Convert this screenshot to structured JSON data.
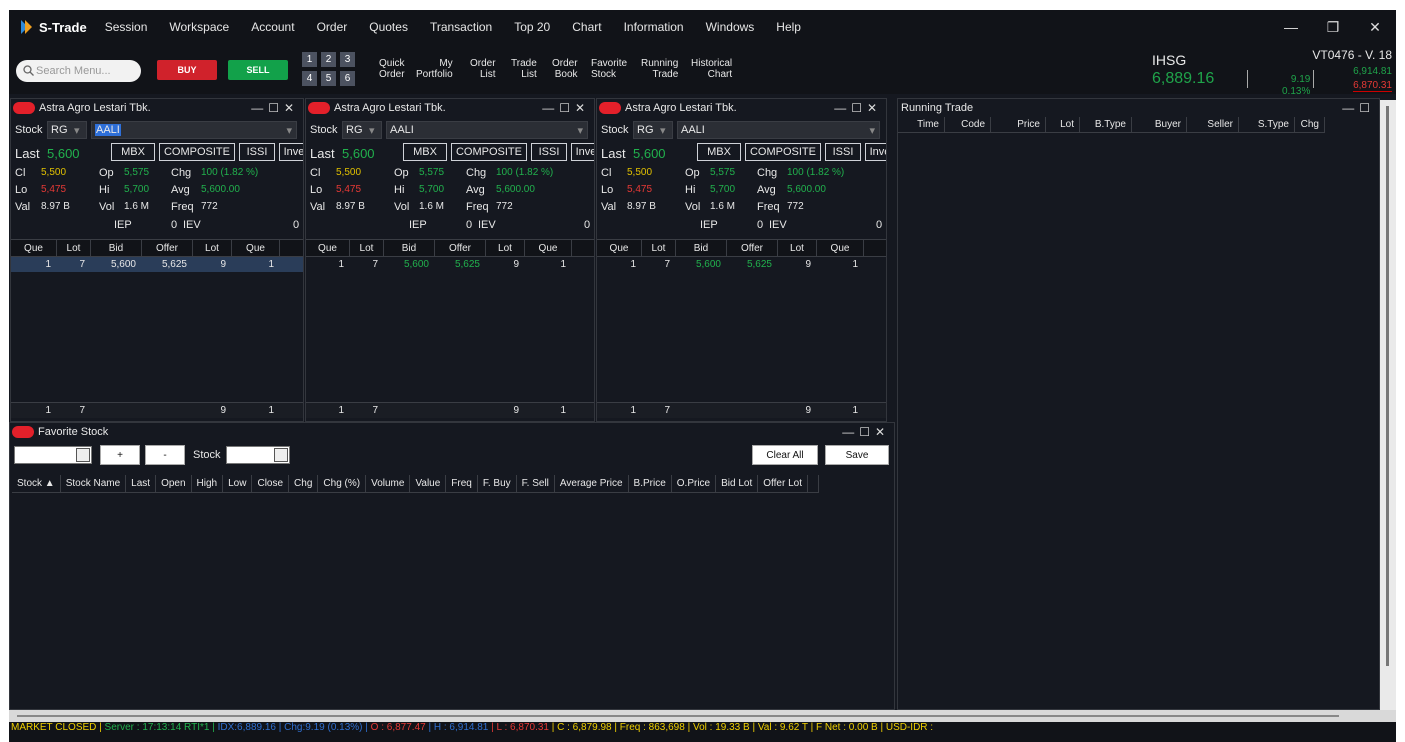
{
  "app": {
    "name": "S-Trade"
  },
  "menu": [
    "Session",
    "Workspace",
    "Account",
    "Order",
    "Quotes",
    "Transaction",
    "Top 20",
    "Chart",
    "Information",
    "Windows",
    "Help"
  ],
  "window_controls": {
    "minimize": "—",
    "restore": "❐",
    "close": "✕"
  },
  "toolbar": {
    "search_placeholder": "Search Menu...",
    "buy": "BUY",
    "sell": "SELL",
    "num_buttons": [
      "1",
      "2",
      "3",
      "4",
      "5",
      "6"
    ],
    "tool_buttons": [
      {
        "l1": "Quick",
        "l2": "Order"
      },
      {
        "l1": "My",
        "l2": "Portfolio"
      },
      {
        "l1": "Order",
        "l2": "List"
      },
      {
        "l1": "Trade",
        "l2": "List"
      },
      {
        "l1": "Order",
        "l2": "Book"
      },
      {
        "l1": "Favorite",
        "l2": "Stock"
      },
      {
        "l1": "Running",
        "l2": "Trade"
      },
      {
        "l1": "Historical",
        "l2": "Chart"
      }
    ]
  },
  "ihsg": {
    "name": "IHSG",
    "value": "6,889.16",
    "chg": "9.19",
    "chg_pct": "0.13%",
    "account": "VT0476 - V. 18",
    "high": "6,914.81",
    "low": "6,870.31"
  },
  "quote": {
    "title": "Astra Agro Lestari Tbk.",
    "stock_label": "Stock",
    "board": "RG",
    "code": "AALI",
    "last_label": "Last",
    "last": "5,600",
    "tabs": [
      "MBX",
      "COMPOSITE",
      "ISSI",
      "Inve"
    ],
    "cl_label": "Cl",
    "cl": "5,500",
    "op_label": "Op",
    "op": "5,575",
    "chg_label": "Chg",
    "chg": "100 (1.82 %)",
    "lo_label": "Lo",
    "lo": "5,475",
    "hi_label": "Hi",
    "hi": "5,700",
    "avg_label": "Avg",
    "avg": "5,600.00",
    "val_label": "Val",
    "val": "8.97 B",
    "vol_label": "Vol",
    "vol": "1.6 M",
    "freq_label": "Freq",
    "freq": "772",
    "iep_label": "IEP",
    "iep": "0",
    "iev_label": "IEV",
    "iev": "0",
    "ob_headers": [
      "Que",
      "Lot",
      "Bid",
      "Offer",
      "Lot",
      "Que"
    ],
    "ob_row": [
      "1",
      "7",
      "5,600",
      "5,625",
      "9",
      "1"
    ],
    "ob_foot": [
      "1",
      "7",
      "",
      "",
      "9",
      "1"
    ]
  },
  "favorite": {
    "title": "Favorite Stock",
    "plus": "+",
    "minus": "-",
    "stock_label": "Stock",
    "clear_all": "Clear All",
    "save": "Save",
    "columns": [
      "Stock ▲",
      "Stock Name",
      "Last",
      "Open",
      "High",
      "Low",
      "Close",
      "Chg",
      "Chg (%)",
      "Volume",
      "Value",
      "Freq",
      "F. Buy",
      "F. Sell",
      "Average Price",
      "B.Price",
      "O.Price",
      "Bid Lot",
      "Offer Lot",
      ""
    ]
  },
  "running_trade": {
    "title": "Running Trade",
    "columns": [
      "Time",
      "Code",
      "Price",
      "Lot",
      "B.Type",
      "Buyer",
      "Seller",
      "S.Type",
      "Chg"
    ]
  },
  "status_bar": {
    "market": "MARKET CLOSED |",
    "server": " Server : 17:13:14  RTI*1 | ",
    "idx": " IDX:6,889.16 | Chg:9.19 (0.13%)  |",
    "o": " O : 6,877.47 ",
    "h": " | H : 6,914.81 ",
    "l": " | L : 6,870.31 ",
    "rest": " | C : 6,879.98   | Freq : 863,698   | Vol : 19.33 B   | Val : 9.62 T | F Net : 0.00 B | USD-IDR : "
  },
  "colors": {
    "green": "#21b14d",
    "red": "#e53935",
    "buy": "#d0222b",
    "sell": "#12a14a",
    "status_yellow": "#f0d000"
  }
}
